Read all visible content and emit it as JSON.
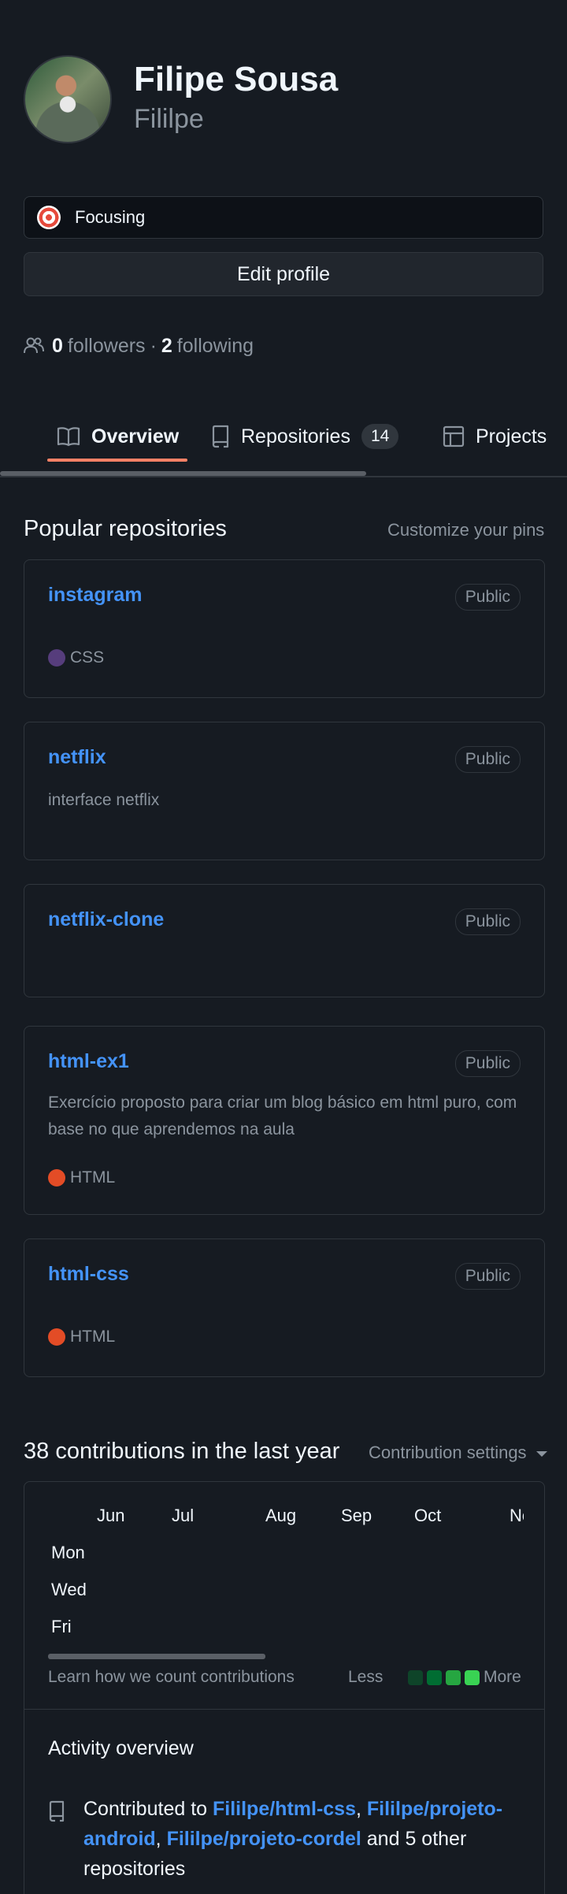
{
  "profile": {
    "name": "Filipe Sousa",
    "login": "Fililpe",
    "status": "Focusing",
    "edit_label": "Edit profile",
    "followers_count": "0",
    "followers_label": "followers",
    "separator": "·",
    "following_count": "2",
    "following_label": "following"
  },
  "tabs": [
    {
      "label": "Overview",
      "icon": "book-icon"
    },
    {
      "label": "Repositories",
      "icon": "repo-icon",
      "count": "14"
    },
    {
      "label": "Projects",
      "icon": "table-icon"
    }
  ],
  "popular": {
    "title": "Popular repositories",
    "customize_label": "Customize your pins",
    "repos": [
      {
        "name": "instagram",
        "badge": "Public",
        "description": "",
        "language": "CSS",
        "language_color": "#563d7c"
      },
      {
        "name": "netflix",
        "badge": "Public",
        "description": "interface netflix",
        "language": "",
        "language_color": ""
      },
      {
        "name": "netflix-clone",
        "badge": "Public",
        "description": "",
        "language": "",
        "language_color": ""
      },
      {
        "name": "html-ex1",
        "badge": "Public",
        "description": "Exercício proposto para criar um blog básico em html puro, com base no que aprendemos na aula",
        "language": "HTML",
        "language_color": "#e34c26"
      },
      {
        "name": "html-css",
        "badge": "Public",
        "description": "",
        "language": "HTML",
        "language_color": "#e34c26"
      }
    ]
  },
  "contributions": {
    "title": "38 contributions in the last year",
    "settings_label": "Contribution settings",
    "months": [
      "Jun",
      "Jul",
      "Aug",
      "Sep",
      "Oct",
      "No"
    ],
    "days": [
      "Mon",
      "Wed",
      "Fri"
    ],
    "learn_label": "Learn how we count contributions",
    "less_label": "Less",
    "more_label": "More",
    "legend_colors": [
      "#0e4429",
      "#006d32",
      "#26a641",
      "#39d353"
    ]
  },
  "activity": {
    "title": "Activity overview",
    "prefix": "Contributed to",
    "repos": [
      "Fililpe/html-css",
      "Fililpe/projeto-android",
      "Fililpe/projeto-cordel"
    ],
    "sep1": ",",
    "sep2": ",",
    "suffix": "and 5 other repositories"
  }
}
